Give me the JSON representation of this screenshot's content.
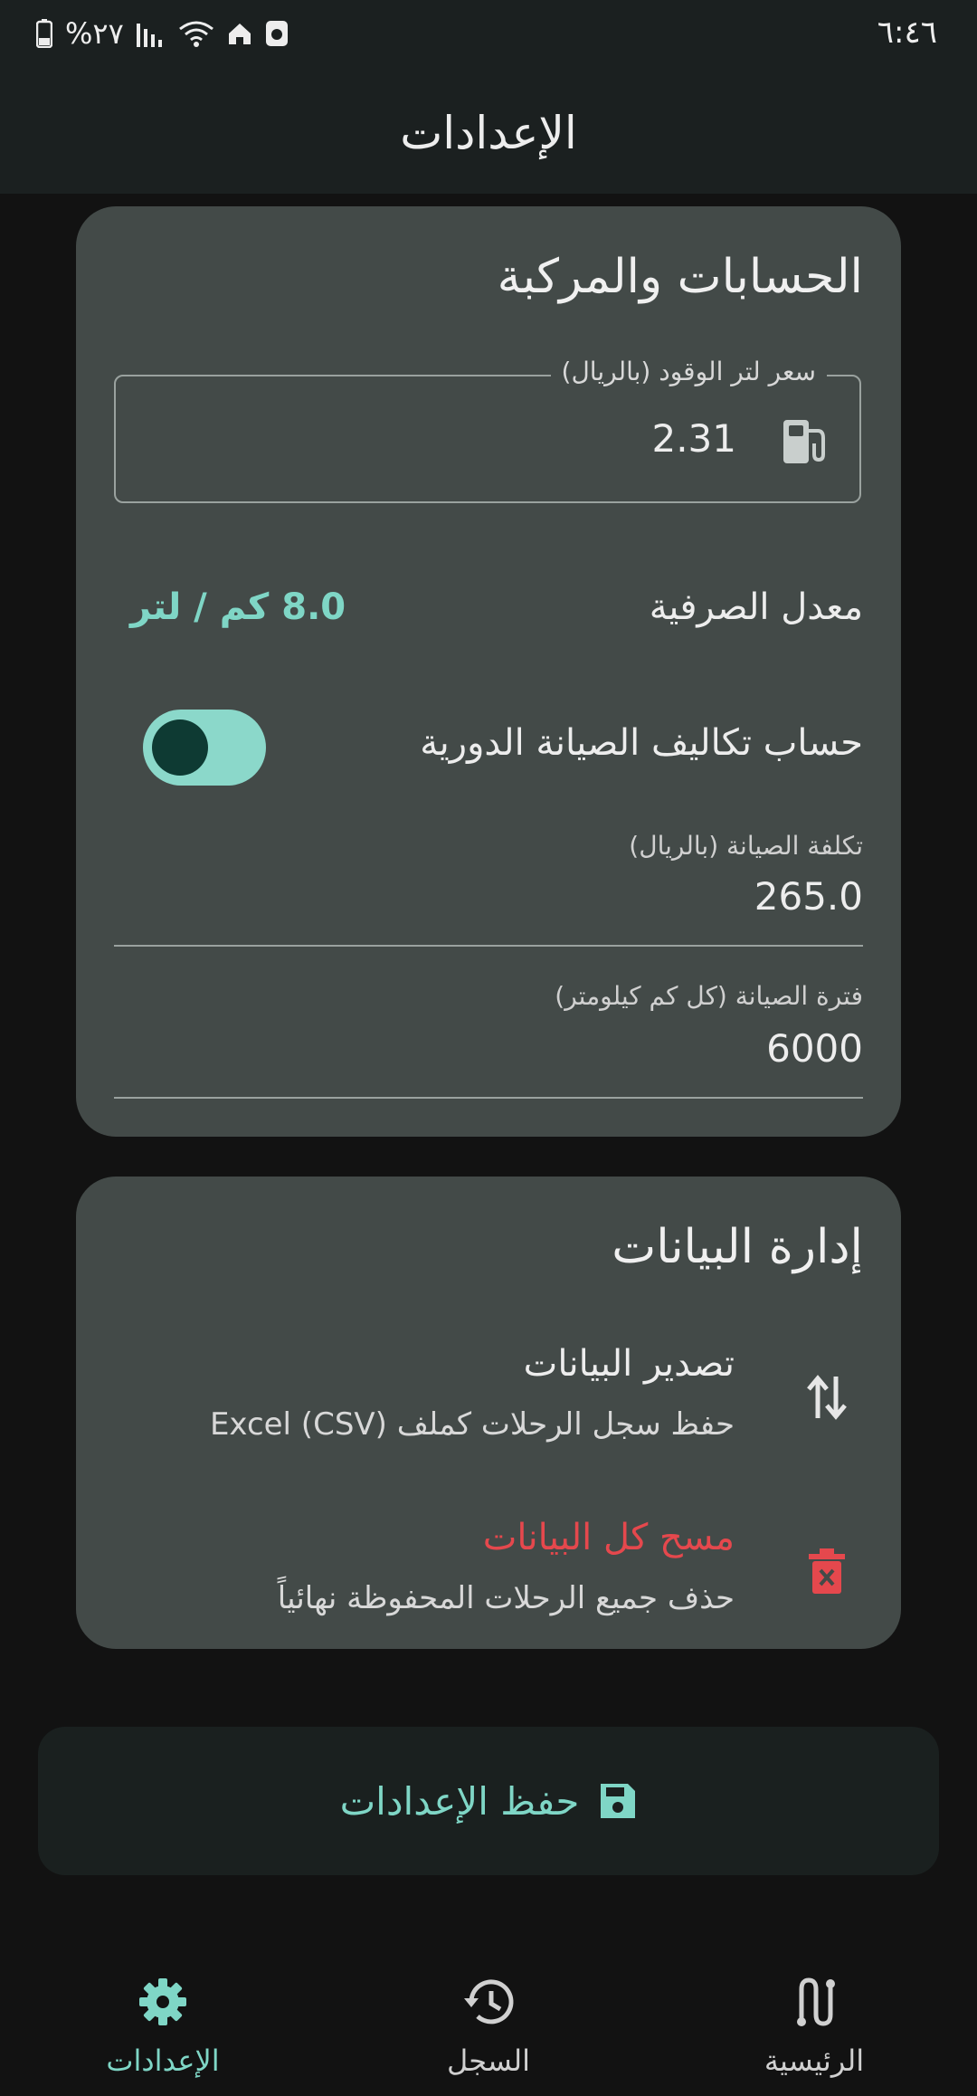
{
  "status_bar": {
    "time": "٦:٤٦",
    "battery": "%٢٧"
  },
  "app_bar": {
    "title": "الإعدادات"
  },
  "calc_card": {
    "title": "الحسابات والمركبة",
    "fuel_price": {
      "label": "سعر لتر الوقود (بالريال)",
      "value": "2.31"
    },
    "consumption": {
      "label": "معدل الصرفية",
      "value": "8.0 كم / لتر"
    },
    "maintenance_toggle": {
      "label": "حساب تكاليف الصيانة الدورية",
      "on": true
    },
    "maintenance_cost": {
      "label": "تكلفة الصيانة (بالريال)",
      "value": "265.0"
    },
    "maintenance_interval": {
      "label": "فترة الصيانة (كل كم كيلومتر)",
      "value": "6000"
    }
  },
  "data_card": {
    "title": "إدارة البيانات",
    "export": {
      "title": "تصدير البيانات",
      "subtitle": "حفظ سجل الرحلات كملف Excel (CSV)"
    },
    "clear": {
      "title": "مسح كل البيانات",
      "subtitle": "حذف جميع الرحلات المحفوظة نهائياً"
    }
  },
  "save_button": {
    "label": "حفظ الإعدادات"
  },
  "bottom_nav": {
    "settings": "الإعدادات",
    "history": "السجل",
    "home": "الرئيسية"
  },
  "colors": {
    "accent": "#7FD6C6",
    "danger": "#E5484D",
    "card": "#434A48",
    "background": "#121212"
  },
  "icons": [
    "fuel-pump-icon",
    "swap-vertical-icon",
    "trash-icon",
    "save-icon",
    "gear-icon",
    "history-icon",
    "route-icon"
  ]
}
